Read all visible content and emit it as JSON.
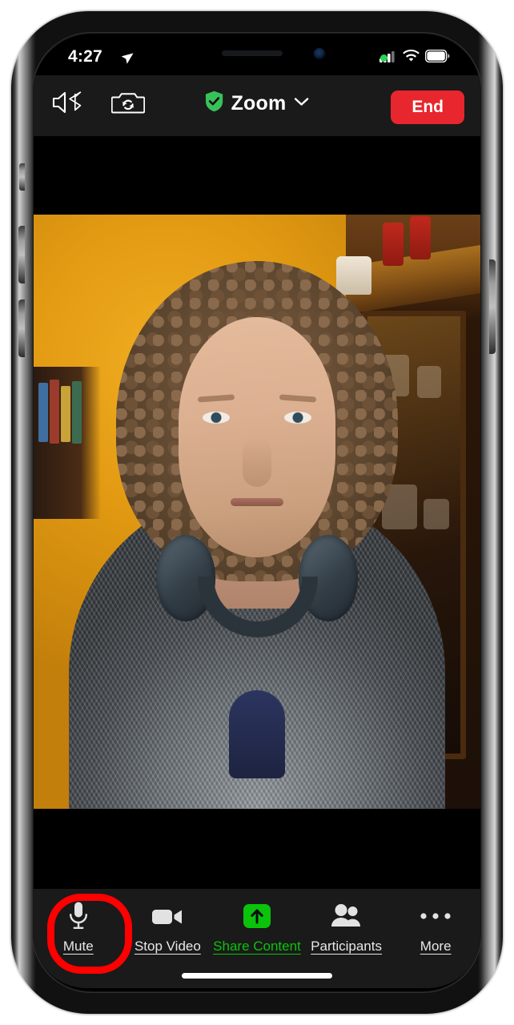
{
  "device": {
    "name": "iphone-x",
    "status_bar": {
      "time": "4:27",
      "location_icon": "location-arrow-icon",
      "cellular_icon": "cellular-signal-icon",
      "wifi_icon": "wifi-icon",
      "battery_icon": "battery-icon",
      "camera_active_indicator": "camera-active-dot"
    },
    "home_indicator": "home-indicator"
  },
  "app": {
    "name": "Zoom",
    "top_bar": {
      "speaker_button": {
        "icon": "speaker-bluetooth-icon",
        "label": ""
      },
      "flip_camera_button": {
        "icon": "flip-camera-icon",
        "label": ""
      },
      "title": "Zoom",
      "title_shield_icon": "shield-check-icon",
      "title_chevron_icon": "chevron-down-icon",
      "end_button_label": "End"
    },
    "video": {
      "participant_label": "",
      "wall_color": "#d4900f",
      "cabinet_color": "#5a3312"
    },
    "toolbar": {
      "items": [
        {
          "label": "Mute",
          "icon": "microphone-icon",
          "highlighted": true,
          "color": "#e8e8e8"
        },
        {
          "label": "Stop Video",
          "icon": "video-camera-icon",
          "highlighted": false,
          "color": "#e8e8e8"
        },
        {
          "label": "Share Content",
          "icon": "share-up-arrow-icon",
          "highlighted": false,
          "color": "#0ac30a"
        },
        {
          "label": "Participants",
          "icon": "participants-people-icon",
          "highlighted": false,
          "color": "#e8e8e8"
        },
        {
          "label": "More",
          "icon": "more-ellipsis-icon",
          "highlighted": false,
          "color": "#e8e8e8"
        }
      ],
      "highlight_color": "#ff0000"
    }
  },
  "colors": {
    "end_button": "#e8262d",
    "share_green": "#0ac30a",
    "shield_green": "#38c15a",
    "bar_background": "#1a1a1a",
    "highlight_red": "#ff0000"
  }
}
